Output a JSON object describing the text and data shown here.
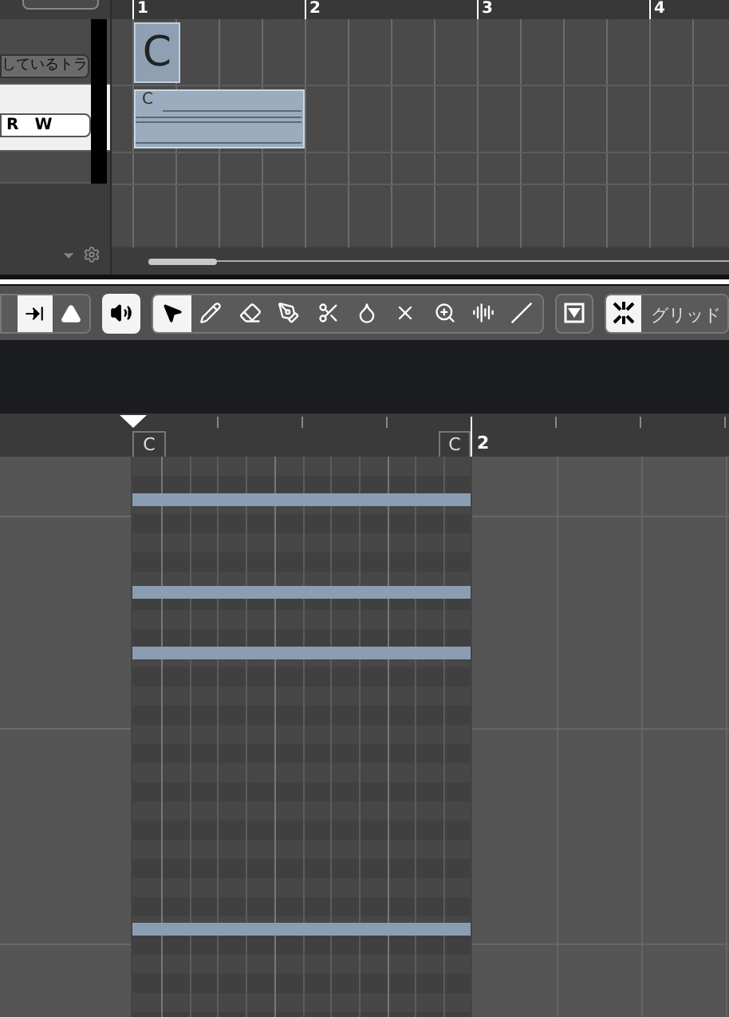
{
  "track_list": {
    "track_label": "しているトラ",
    "selected_track": {
      "selected": true,
      "record_button": "R",
      "write_button": "W"
    }
  },
  "arrange_ruler": {
    "bars": [
      "1",
      "2",
      "3",
      "4"
    ]
  },
  "chord_event": {
    "label": "C"
  },
  "midi_part": {
    "label": "C"
  },
  "toolbar": {
    "left_buttons": [
      {
        "kind": "split",
        "on": true
      },
      {
        "kind": "dropdown",
        "on": false
      },
      {
        "kind": "speaker",
        "on": true
      }
    ],
    "tools": [
      {
        "kind": "arrow",
        "selected": true
      },
      {
        "kind": "pencil",
        "selected": false
      },
      {
        "kind": "eraser",
        "selected": false
      },
      {
        "kind": "pen",
        "selected": false
      },
      {
        "kind": "scissors",
        "selected": false
      },
      {
        "kind": "glue",
        "selected": false
      },
      {
        "kind": "mute",
        "selected": false
      },
      {
        "kind": "zoom",
        "selected": false
      },
      {
        "kind": "velocity",
        "selected": false
      },
      {
        "kind": "line",
        "selected": false
      }
    ],
    "panel_button": {
      "on": false
    },
    "snap": {
      "on": true,
      "label": "グリッド"
    }
  },
  "editor_ruler": {
    "chord_markers": [
      "C",
      "C"
    ],
    "bar": "2"
  }
}
